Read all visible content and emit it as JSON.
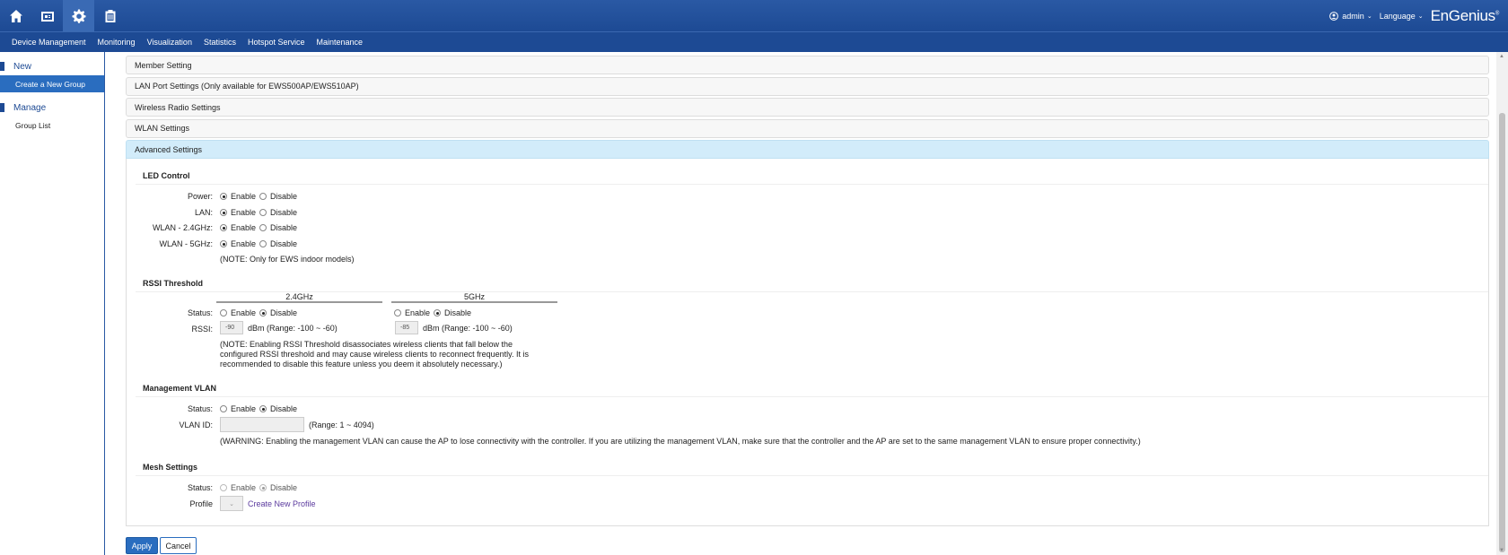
{
  "header": {
    "user": "admin",
    "language": "Language",
    "brand": "EnGenius"
  },
  "nav": [
    "Device Management",
    "Monitoring",
    "Visualization",
    "Statistics",
    "Hotspot Service",
    "Maintenance"
  ],
  "sidebar": {
    "new_heading": "New",
    "create_group": "Create a New Group",
    "manage_heading": "Manage",
    "group_list": "Group List"
  },
  "accordion": {
    "member": "Member Setting",
    "lan_port": "LAN Port Settings (Only available for EWS500AP/EWS510AP)",
    "wireless_radio": "Wireless Radio Settings",
    "wlan": "WLAN Settings",
    "advanced": "Advanced Settings"
  },
  "common": {
    "enable": "Enable",
    "disable": "Disable"
  },
  "led": {
    "title": "LED Control",
    "power_label": "Power:",
    "lan_label": "LAN:",
    "wlan24_label": "WLAN - 2.4GHz:",
    "wlan5_label": "WLAN - 5GHz:",
    "note": "(NOTE: Only for EWS indoor models)"
  },
  "rssi": {
    "title": "RSSI Threshold",
    "band1": "2.4GHz",
    "band2": "5GHz",
    "status_label": "Status:",
    "rssi_label": "RSSI:",
    "value1": "-90",
    "value2": "-85",
    "range1": "dBm (Range: -100 ~ -60)",
    "range2": "dBm (Range: -100 ~ -60)",
    "note": "(NOTE: Enabling RSSI Threshold disassociates wireless clients that fall below the configured RSSI threshold and may cause wireless clients to reconnect frequently. It is recommended to disable this feature unless you deem it absolutely necessary.)"
  },
  "mgmt_vlan": {
    "title": "Management VLAN",
    "status_label": "Status:",
    "vlan_id_label": "VLAN ID:",
    "range": "(Range: 1 ~ 4094)",
    "warning": "(WARNING: Enabling the management VLAN can cause the AP to lose connectivity with the controller. If you are utilizing the management VLAN, make sure that the controller and the AP are set to the same management VLAN to ensure proper connectivity.)"
  },
  "mesh": {
    "title": "Mesh Settings",
    "status_label": "Status:",
    "profile_label": "Profile",
    "create_profile": "Create New Profile"
  },
  "buttons": {
    "apply": "Apply",
    "cancel": "Cancel"
  }
}
